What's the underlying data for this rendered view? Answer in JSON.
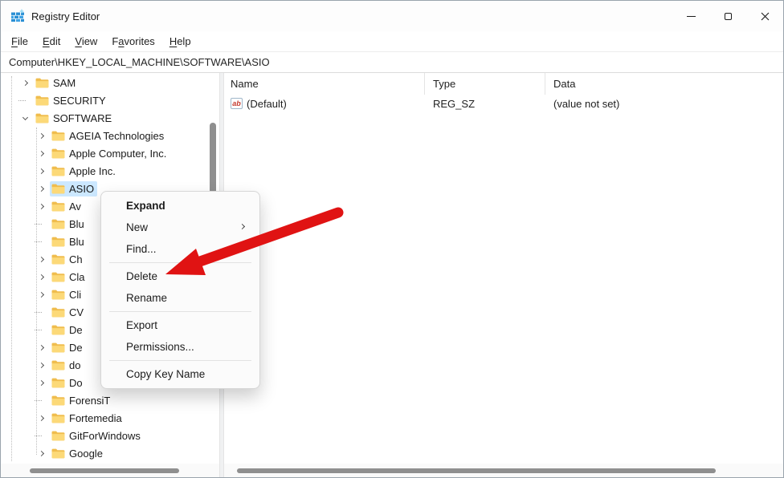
{
  "window": {
    "title": "Registry Editor"
  },
  "menu_bar": {
    "items": [
      {
        "pre": "",
        "key": "F",
        "post": "ile"
      },
      {
        "pre": "",
        "key": "E",
        "post": "dit"
      },
      {
        "pre": "",
        "key": "V",
        "post": "iew"
      },
      {
        "pre": "F",
        "key": "a",
        "post": "vorites"
      },
      {
        "pre": "",
        "key": "H",
        "post": "elp"
      }
    ]
  },
  "address_bar": {
    "value": "Computer\\HKEY_LOCAL_MACHINE\\SOFTWARE\\ASIO"
  },
  "tree": {
    "items": [
      {
        "label": "SAM",
        "level": 1,
        "state": "collapsed",
        "selected": false
      },
      {
        "label": "SECURITY",
        "level": 1,
        "state": "leaf",
        "selected": false
      },
      {
        "label": "SOFTWARE",
        "level": 1,
        "state": "expanded",
        "selected": false
      },
      {
        "label": "AGEIA Technologies",
        "level": 2,
        "state": "collapsed",
        "selected": false
      },
      {
        "label": "Apple Computer, Inc.",
        "level": 2,
        "state": "collapsed",
        "selected": false
      },
      {
        "label": "Apple Inc.",
        "level": 2,
        "state": "collapsed",
        "selected": false
      },
      {
        "label": "ASIO",
        "level": 2,
        "state": "collapsed",
        "selected": true
      },
      {
        "label": "Av",
        "level": 2,
        "state": "collapsed",
        "selected": false
      },
      {
        "label": "Blu",
        "level": 2,
        "state": "leaf",
        "selected": false
      },
      {
        "label": "Blu",
        "level": 2,
        "state": "leaf",
        "selected": false
      },
      {
        "label": "Ch",
        "level": 2,
        "state": "collapsed",
        "selected": false
      },
      {
        "label": "Cla",
        "level": 2,
        "state": "collapsed",
        "selected": false
      },
      {
        "label": "Cli",
        "level": 2,
        "state": "collapsed",
        "selected": false
      },
      {
        "label": "CV",
        "level": 2,
        "state": "leaf",
        "selected": false
      },
      {
        "label": "De",
        "level": 2,
        "state": "leaf",
        "selected": false
      },
      {
        "label": "De",
        "level": 2,
        "state": "collapsed",
        "selected": false
      },
      {
        "label": "do",
        "level": 2,
        "state": "collapsed",
        "selected": false
      },
      {
        "label": "Do",
        "level": 2,
        "state": "collapsed",
        "selected": false
      },
      {
        "label": "ForensiT",
        "level": 2,
        "state": "leaf",
        "selected": false
      },
      {
        "label": "Fortemedia",
        "level": 2,
        "state": "collapsed",
        "selected": false
      },
      {
        "label": "GitForWindows",
        "level": 2,
        "state": "leaf",
        "selected": false
      },
      {
        "label": "Google",
        "level": 2,
        "state": "collapsed",
        "selected": false
      }
    ]
  },
  "context_menu": {
    "items": [
      {
        "label": "Expand"
      },
      {
        "label": "New"
      },
      {
        "label": "Find..."
      },
      {
        "label": "Delete"
      },
      {
        "label": "Rename"
      },
      {
        "label": "Export"
      },
      {
        "label": "Permissions..."
      },
      {
        "label": "Copy Key Name"
      }
    ]
  },
  "list": {
    "columns": [
      "Name",
      "Type",
      "Data"
    ],
    "rows": [
      {
        "icon_glyph": "ab",
        "name": "(Default)",
        "type": "REG_SZ",
        "data": "(value not set)"
      }
    ]
  },
  "annotation": {
    "color": "#e01313"
  },
  "colors": {
    "selection": "#cce8ff",
    "scrollbar_thumb": "#8f8f8f"
  }
}
